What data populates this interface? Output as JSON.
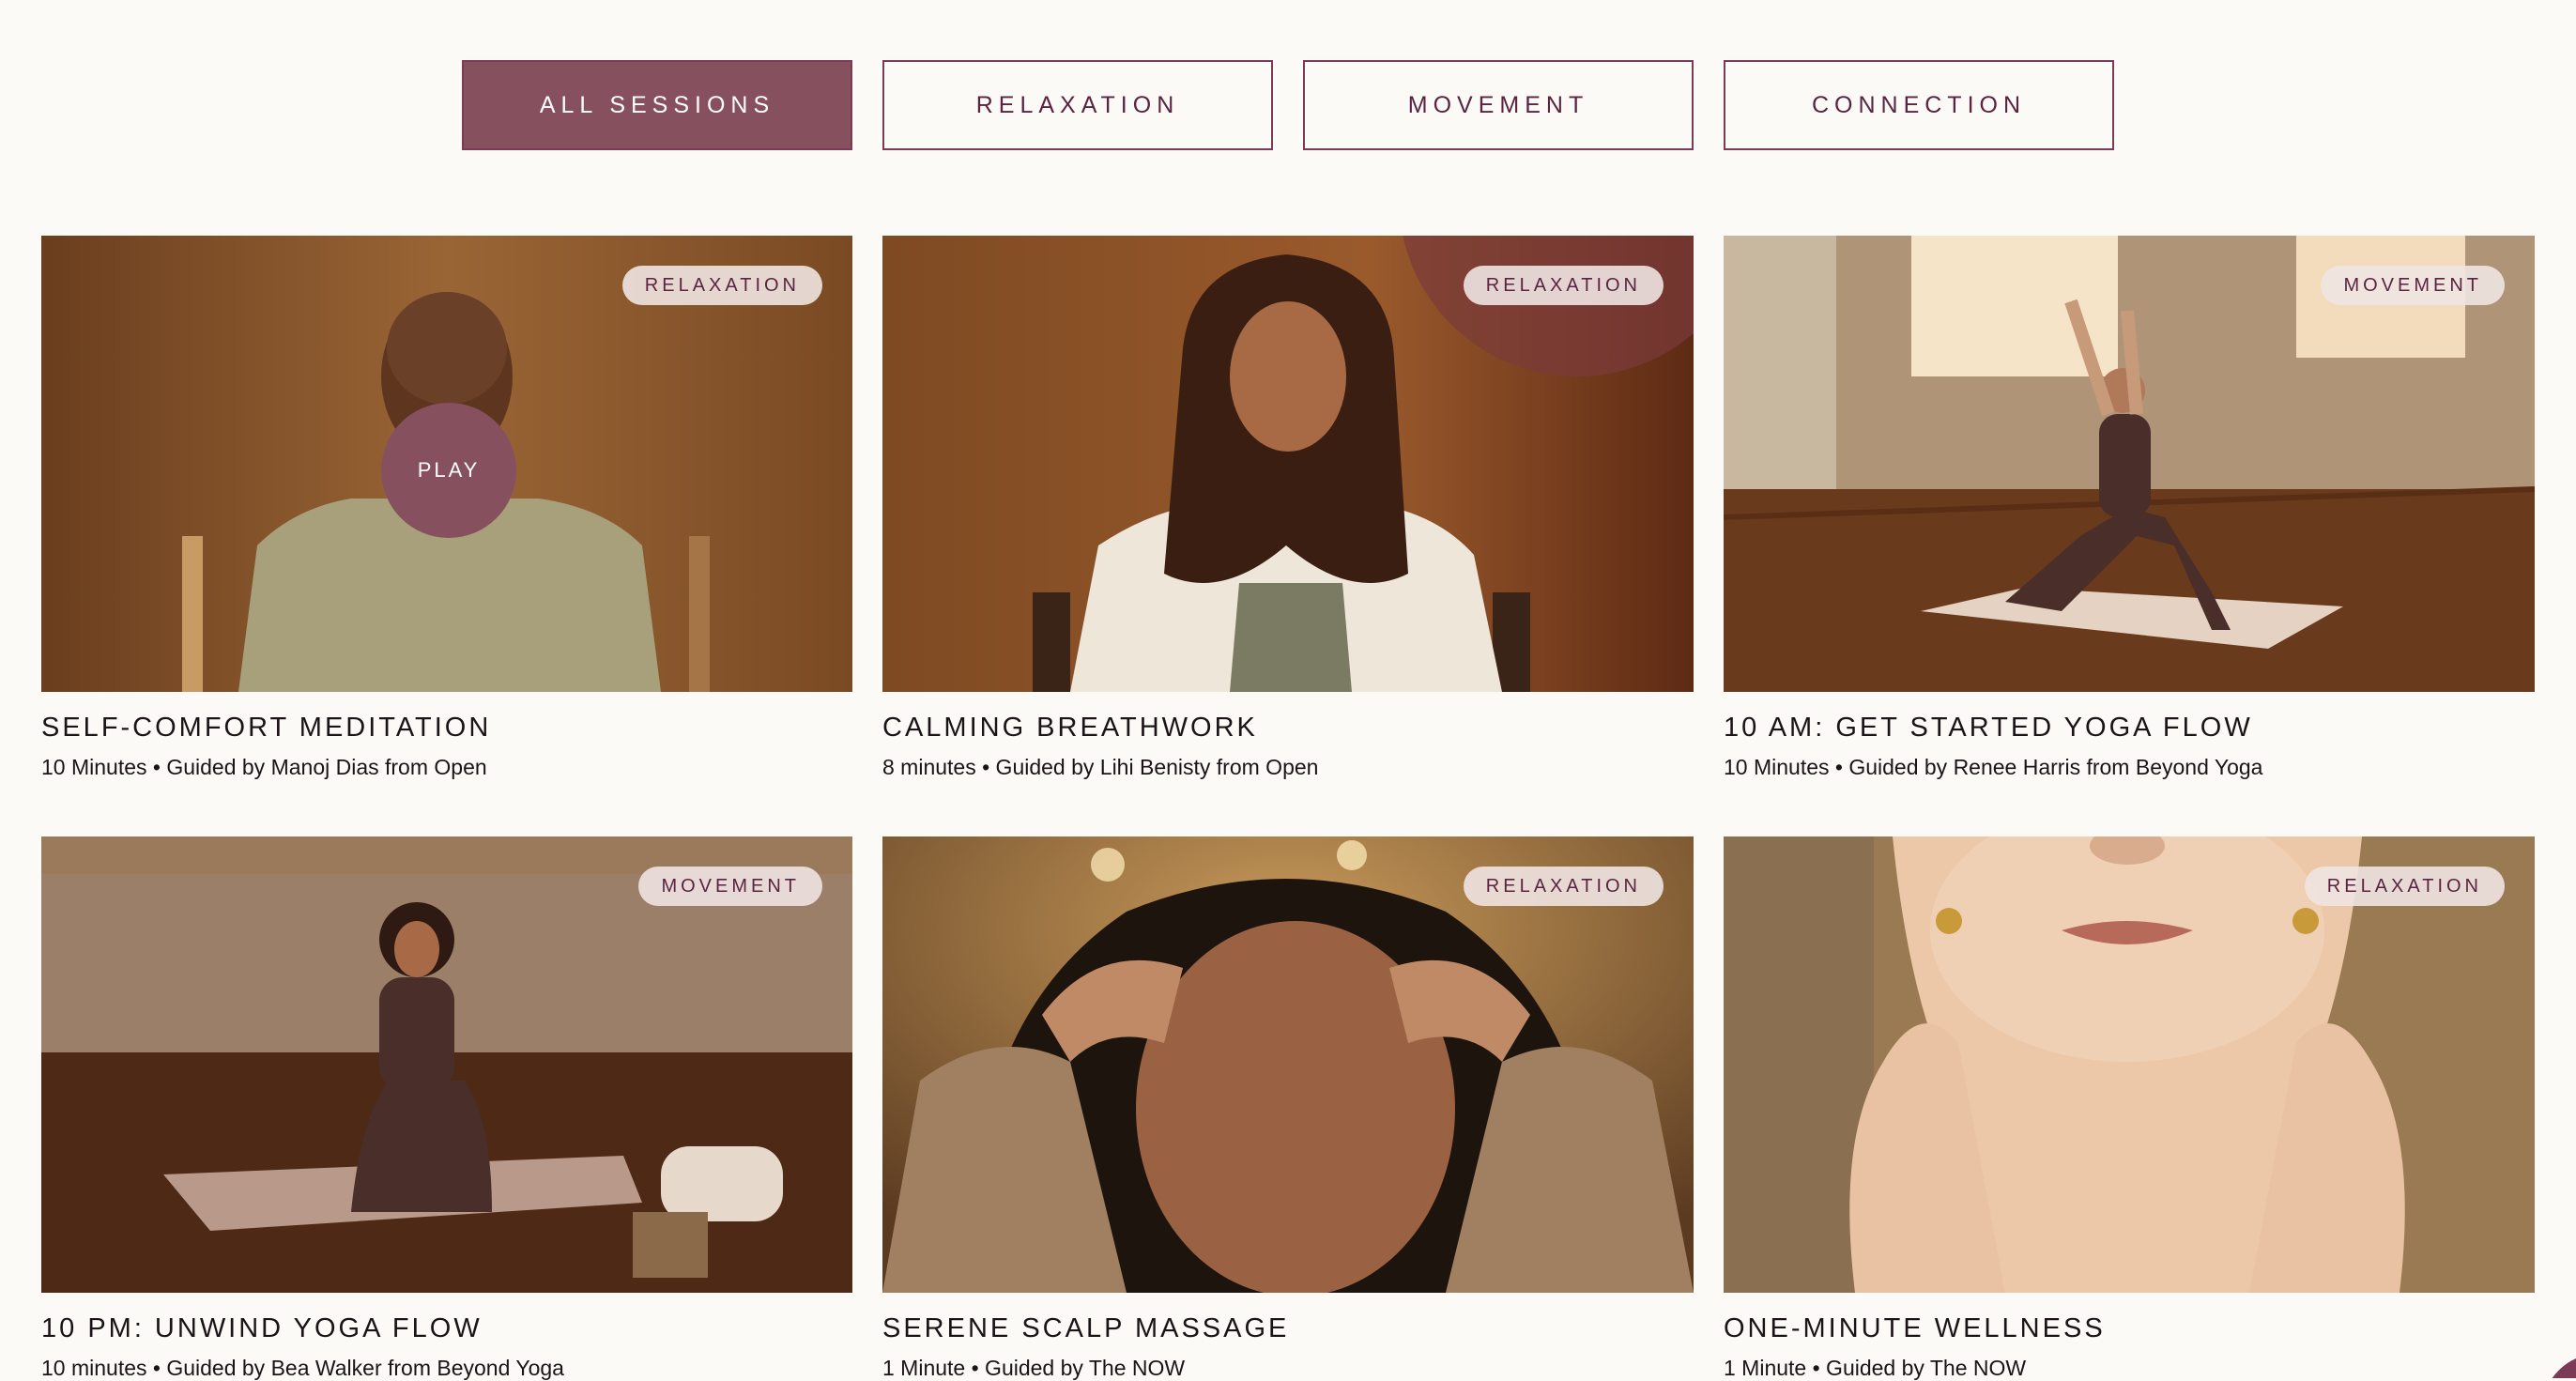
{
  "filters": {
    "tabs": [
      {
        "label": "ALL SESSIONS",
        "active": true
      },
      {
        "label": "RELAXATION",
        "active": false
      },
      {
        "label": "MOVEMENT",
        "active": false
      },
      {
        "label": "CONNECTION",
        "active": false
      }
    ]
  },
  "play_label": "PLAY",
  "sessions": [
    {
      "title": "SELF-COMFORT MEDITATION",
      "meta": "10 Minutes • Guided by Manoj Dias from Open",
      "category": "RELAXATION"
    },
    {
      "title": "CALMING BREATHWORK",
      "meta": "8 minutes • Guided by Lihi Benisty from Open",
      "category": "RELAXATION"
    },
    {
      "title": "10 AM: GET STARTED YOGA FLOW",
      "meta": "10 Minutes • Guided by Renee Harris from Beyond Yoga",
      "category": "MOVEMENT"
    },
    {
      "title": "10 PM: UNWIND YOGA FLOW",
      "meta": "10 minutes • Guided by Bea Walker from Beyond Yoga",
      "category": "MOVEMENT"
    },
    {
      "title": "SERENE SCALP MASSAGE",
      "meta": "1 Minute • Guided by The NOW",
      "category": "RELAXATION"
    },
    {
      "title": "ONE-MINUTE WELLNESS",
      "meta": "1 Minute • Guided by The NOW",
      "category": "RELAXATION"
    }
  ],
  "colors": {
    "background": "#fcfaf6",
    "accent": "#86505f",
    "accent_border": "#7b3a55",
    "tab_text": "#5a2440"
  }
}
